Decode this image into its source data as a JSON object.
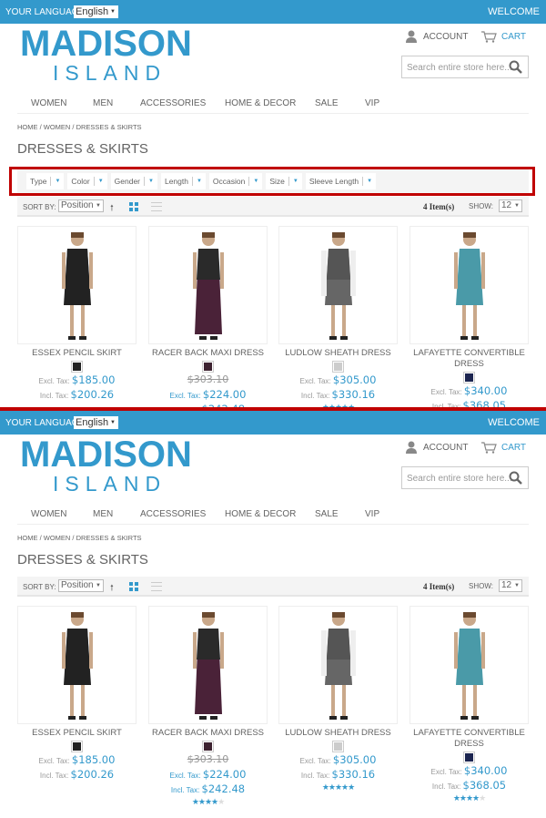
{
  "header": {
    "language_label": "YOUR LANGUAGE:",
    "language_value": "English",
    "welcome": "WELCOME",
    "logo_top": "MADISON",
    "logo_bottom": "ISLAND",
    "account": "ACCOUNT",
    "cart": "CART",
    "search_placeholder": "Search entire store here..."
  },
  "nav": [
    "WOMEN",
    "MEN",
    "ACCESSORIES",
    "HOME & DECOR",
    "SALE",
    "VIP"
  ],
  "breadcrumb": "HOME  /  WOMEN  /  DRESSES & SKIRTS",
  "title": "DRESSES & SKIRTS",
  "filters": [
    "Type",
    "Color",
    "Gender",
    "Length",
    "Occasion",
    "Size",
    "Sleeve Length"
  ],
  "toolbar": {
    "sort_label": "SORT BY:",
    "sort_value": "Position",
    "items": "4 Item(s)",
    "show_label": "SHOW:",
    "show_value": "12"
  },
  "accent": "#3399cc",
  "highlight": "#c00000",
  "products": [
    {
      "name": "ESSEX PENCIL SKIRT",
      "swatch": "#222222",
      "excl_label": "Excl. Tax:",
      "excl": "$185.00",
      "incl_label": "Incl. Tax:",
      "incl": "$200.26",
      "rating": 0
    },
    {
      "name": "RACER BACK MAXI DRESS",
      "swatch": "#3d2230",
      "old": "$303.10",
      "excl_label": "Excl. Tax:",
      "excl": "$224.00",
      "incl_label": "Incl. Tax:",
      "incl": "$242.48",
      "rating": 4
    },
    {
      "name": "LUDLOW SHEATH DRESS",
      "swatch": "#cccccc",
      "excl_label": "Excl. Tax:",
      "excl": "$305.00",
      "incl_label": "Incl. Tax:",
      "incl": "$330.16",
      "rating": 4.5
    },
    {
      "name": "LAFAYETTE CONVERTIBLE DRESS",
      "swatch": "#1c2550",
      "excl_label": "Excl. Tax:",
      "excl": "$340.00",
      "incl_label": "Incl. Tax:",
      "incl": "$368.05",
      "rating": 4
    }
  ]
}
